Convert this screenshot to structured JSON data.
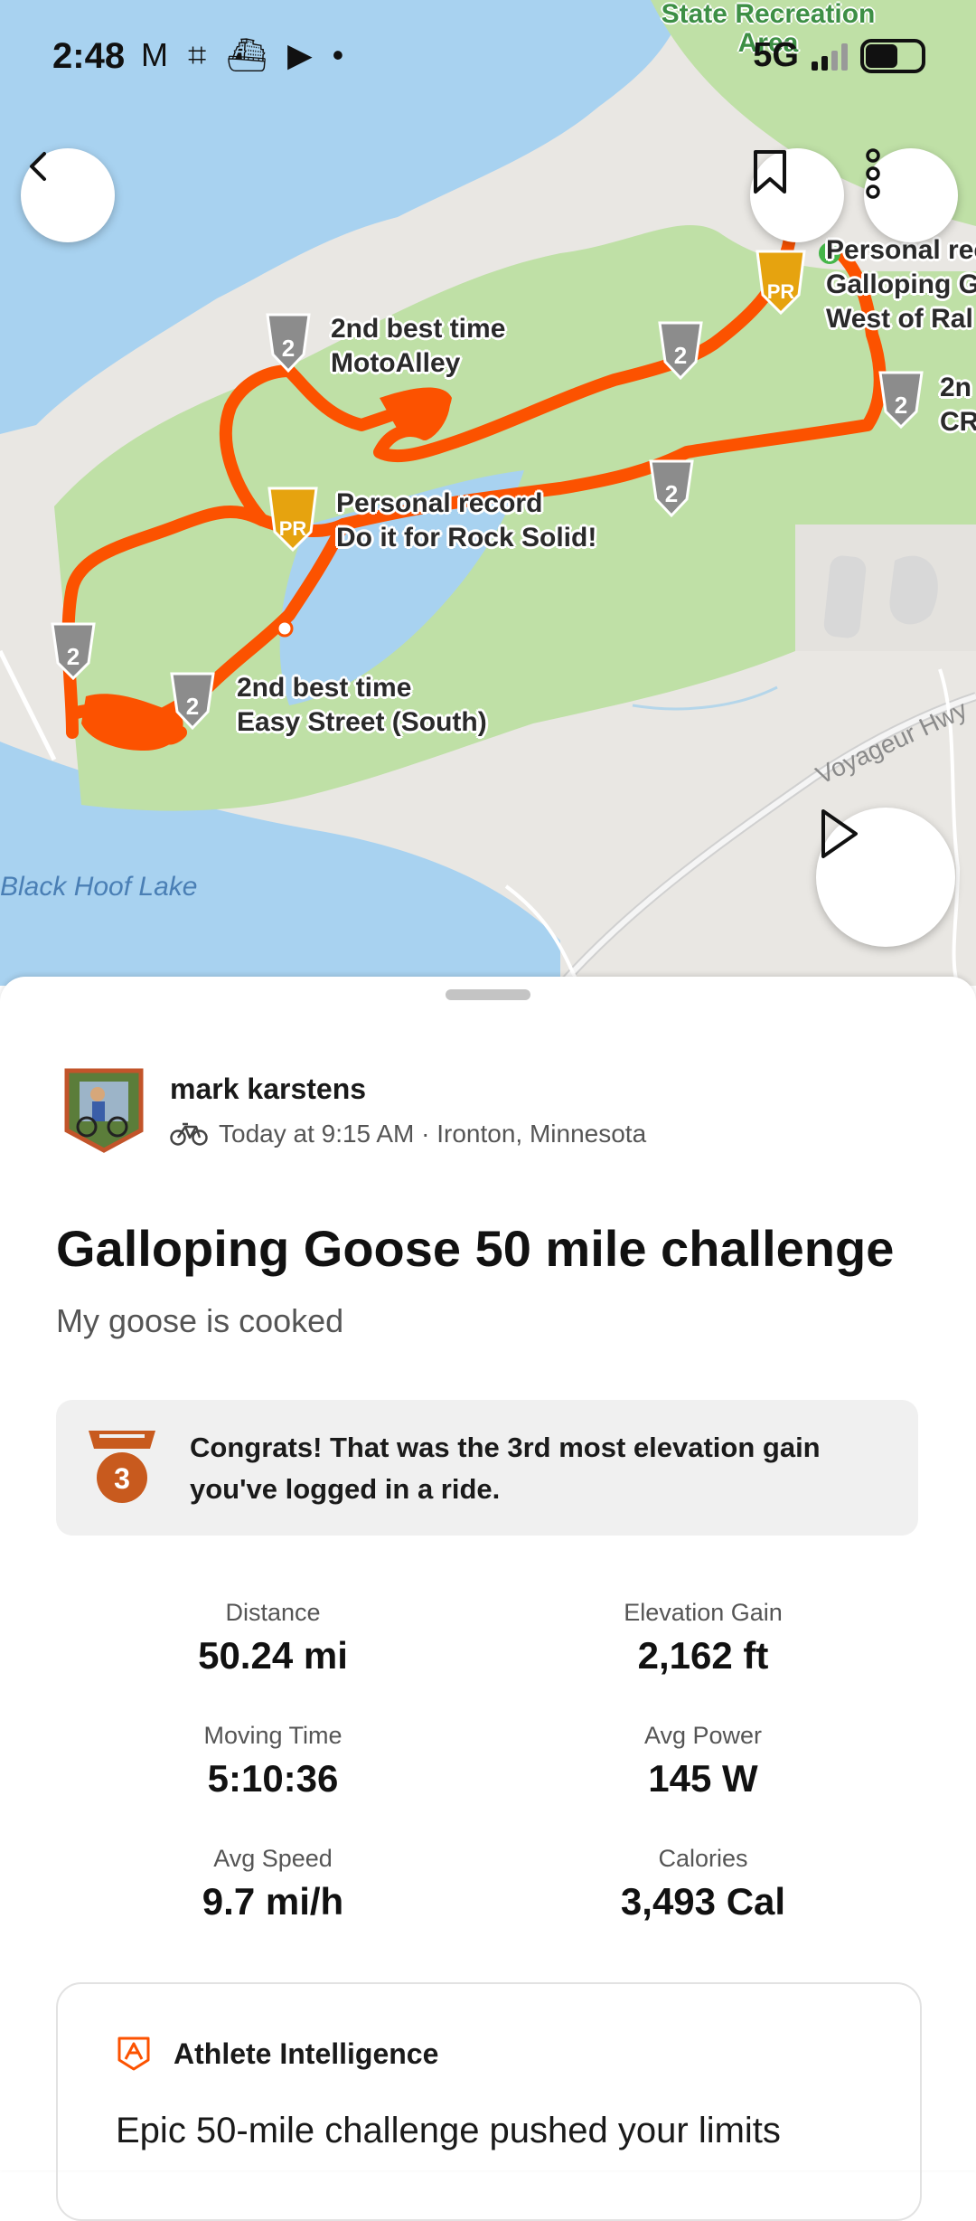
{
  "status_bar": {
    "time": "2:48",
    "icons": "M ⌗ ⛴ ▶ •",
    "network": "5G"
  },
  "map": {
    "park_label": "State Recreation Area",
    "lake_label": "Black Hoof Lake",
    "road_label": "Voyageur Hwy",
    "segment_labels": [
      {
        "line1": "2nd best time",
        "line2": "MotoAlley"
      },
      {
        "line1": "Personal record",
        "line2": "Do it for Rock Solid!"
      },
      {
        "line1": "2nd best time",
        "line2": "Easy Street (South)"
      },
      {
        "line1": "Personal rec",
        "line2": "Galloping G",
        "line3": "West of Ral"
      },
      {
        "line1": "2n",
        "line2": "CR"
      }
    ],
    "badges": {
      "silver": "2",
      "gold": "PR"
    },
    "colors": {
      "route": "#fc5200",
      "water": "#a8d2f0",
      "land": "#e9e7e3",
      "park": "#bfe0a6"
    }
  },
  "activity": {
    "athlete": "mark karstens",
    "datetime_location": "Today at 9:15 AM · Ironton, Minnesota",
    "sport_icon": "bike-icon",
    "title": "Galloping Goose 50 mile challenge",
    "description": "My goose is cooked",
    "achievement": {
      "medal": "3",
      "text": "Congrats! That was the 3rd most elevation gain you've logged in a ride."
    },
    "stats": [
      {
        "label": "Distance",
        "value": "50.24 mi"
      },
      {
        "label": "Elevation Gain",
        "value": "2,162 ft"
      },
      {
        "label": "Moving Time",
        "value": "5:10:36"
      },
      {
        "label": "Avg Power",
        "value": "145 W"
      },
      {
        "label": "Avg Speed",
        "value": "9.7 mi/h"
      },
      {
        "label": "Calories",
        "value": "3,493 Cal"
      }
    ]
  },
  "athlete_intelligence": {
    "title": "Athlete Intelligence",
    "body": "Epic 50-mile challenge pushed your limits"
  },
  "accent": "#fc5200"
}
